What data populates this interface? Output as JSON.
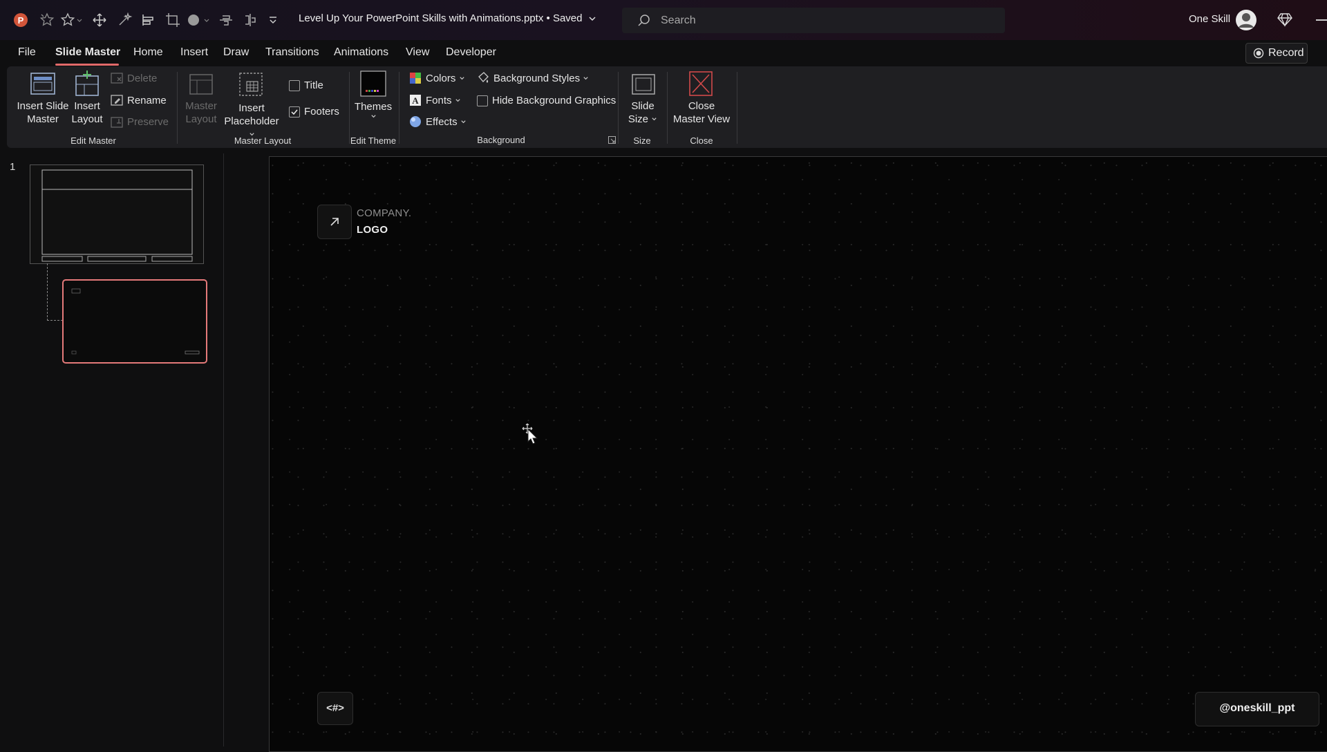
{
  "titlebar": {
    "doc_title": "Level Up Your PowerPoint Skills with Animations.pptx • Saved",
    "search_placeholder": "Search",
    "user_name": "One Skill",
    "icons": [
      "powerpoint-app-icon",
      "quick-access-star",
      "quick-access-star-outline",
      "quick-access-move",
      "quick-access-magic",
      "quick-access-align",
      "quick-access-crop",
      "quick-access-shape",
      "quick-access-distribute",
      "quick-access-group",
      "customize-quick-access"
    ]
  },
  "menu": {
    "tabs": [
      "File",
      "Slide Master",
      "Home",
      "Insert",
      "Draw",
      "Transitions",
      "Animations",
      "View",
      "Developer"
    ],
    "active": "Slide Master",
    "record_label": "Record"
  },
  "ribbon": {
    "edit_master": {
      "group_label": "Edit Master",
      "insert_slide_master": [
        "Insert Slide",
        "Master"
      ],
      "insert_layout": [
        "Insert",
        "Layout"
      ],
      "delete": "Delete",
      "rename": "Rename",
      "preserve": "Preserve"
    },
    "master_layout": {
      "group_label": "Master Layout",
      "master_layout_btn": [
        "Master",
        "Layout"
      ],
      "insert_placeholder": [
        "Insert",
        "Placeholder"
      ],
      "title_checkbox": "Title",
      "title_checked": false,
      "footers_checkbox": "Footers",
      "footers_checked": true
    },
    "edit_theme": {
      "group_label": "Edit Theme",
      "themes": "Themes"
    },
    "background": {
      "group_label": "Background",
      "colors": "Colors",
      "fonts": "Fonts",
      "effects": "Effects",
      "background_styles": "Background Styles",
      "hide_bg_graphics": "Hide Background Graphics",
      "hide_bg_checked": false
    },
    "size": {
      "group_label": "Size",
      "slide_size": [
        "Slide",
        "Size"
      ]
    },
    "close": {
      "group_label": "Close",
      "close_master_view": [
        "Close",
        "Master View"
      ]
    }
  },
  "thumbnails": {
    "slide_number": "1"
  },
  "slide": {
    "logo_line1": "COMPANY.",
    "logo_line2": "LOGO",
    "slide_number_placeholder": "<#>",
    "handle": "@oneskill_ppt"
  },
  "colors": {
    "accent": "#e26a6a",
    "ribbon_bg": "#1f1f22",
    "canvas_bg": "#060606"
  }
}
